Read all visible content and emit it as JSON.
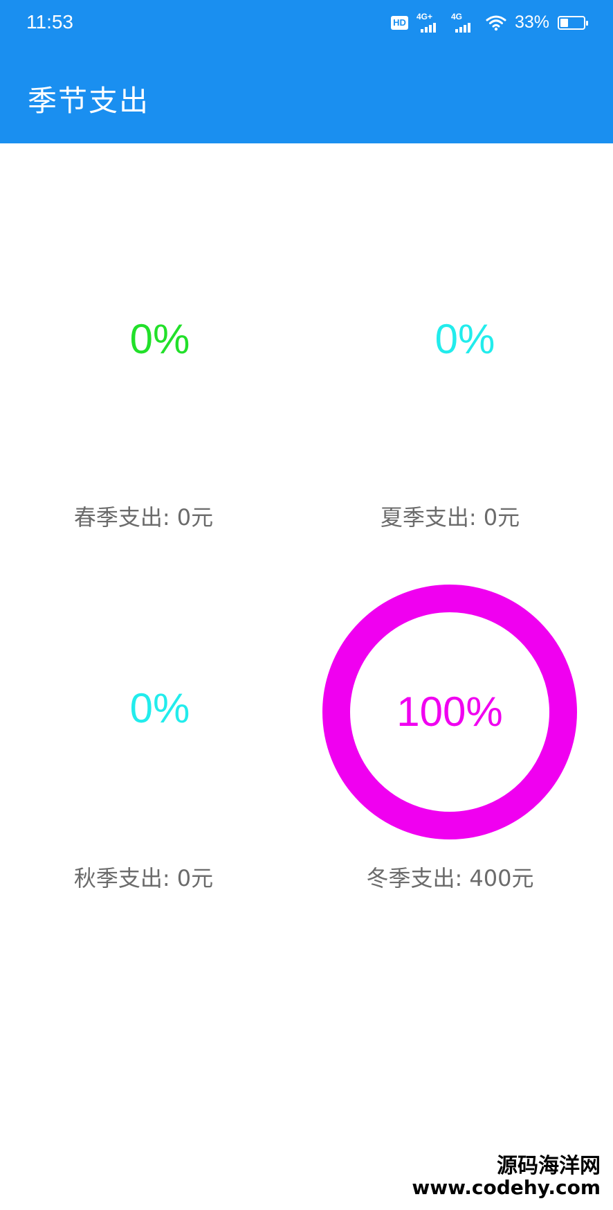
{
  "status_bar": {
    "time": "11:53",
    "hd_badge": "HD",
    "network_1": "4G+",
    "network_2": "4G",
    "battery_percent": "33%",
    "battery_level": 0.33
  },
  "app_bar": {
    "title": "季节支出"
  },
  "seasons": [
    {
      "percent_text": "0%",
      "percent": 0,
      "color": "#22e02a",
      "caption": "春季支出: 0元"
    },
    {
      "percent_text": "0%",
      "percent": 0,
      "color": "#22ecec",
      "caption": "夏季支出: 0元"
    },
    {
      "percent_text": "0%",
      "percent": 0,
      "color": "#22ecec",
      "caption": "秋季支出: 0元"
    },
    {
      "percent_text": "100%",
      "percent": 100,
      "color": "#f000f0",
      "caption": "冬季支出: 400元"
    }
  ],
  "watermark": {
    "line1": "源码海洋网",
    "line2": "www.codehy.com"
  }
}
